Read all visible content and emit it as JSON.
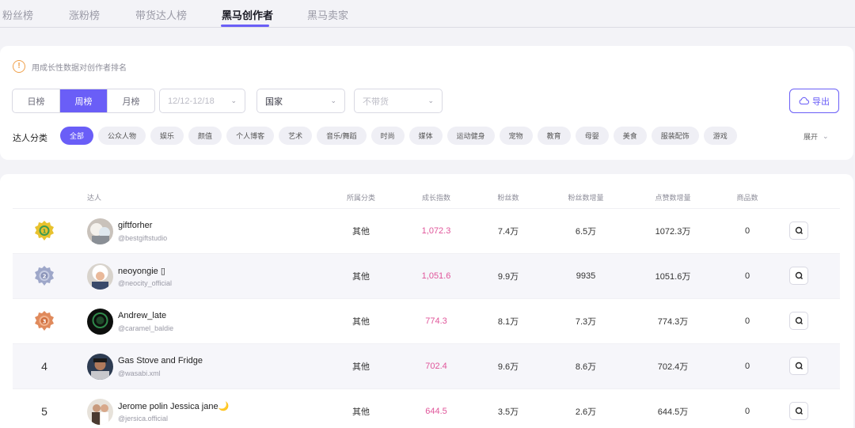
{
  "tabs": [
    {
      "label": "粉丝榜"
    },
    {
      "label": "涨粉榜"
    },
    {
      "label": "带货达人榜"
    },
    {
      "label": "黑马创作者"
    },
    {
      "label": "黑马卖家"
    }
  ],
  "active_tab": "黑马创作者",
  "filters": {
    "hint": "用成长性数据对创作者排名",
    "period": [
      "日榜",
      "周榜",
      "月榜"
    ],
    "period_selected": "周榜",
    "date_placeholder": "12/12-12/18",
    "country": "国家",
    "sales_placeholder": "不带货",
    "export_label": "导出",
    "category_label": "达人分类",
    "categories": [
      "全部",
      "公众人物",
      "娱乐",
      "颜值",
      "个人博客",
      "艺术",
      "音乐/舞蹈",
      "时尚",
      "媒体",
      "运动健身",
      "宠物",
      "教育",
      "母婴",
      "美食",
      "服装配饰",
      "游戏"
    ],
    "category_selected": "全部",
    "expand_label": "展开"
  },
  "table": {
    "headers": {
      "creator": "达人",
      "category": "所属分类",
      "growth": "成长指数",
      "fans": "粉丝数",
      "fans_growth": "粉丝数增量",
      "likes_growth": "点赞数增量",
      "products": "商品数"
    },
    "rows": [
      {
        "rank": "1",
        "medal": "gold",
        "name": "giftforher",
        "handle": "@bestgiftstudio",
        "category": "其他",
        "growth": "1,072.3",
        "fans": "7.4万",
        "fans_growth": "6.5万",
        "likes_growth": "1072.3万",
        "products": "0"
      },
      {
        "rank": "2",
        "medal": "silver",
        "name": "neoyongie ▯",
        "handle": "@neocity_official",
        "category": "其他",
        "growth": "1,051.6",
        "fans": "9.9万",
        "fans_growth": "9935",
        "likes_growth": "1051.6万",
        "products": "0"
      },
      {
        "rank": "3",
        "medal": "bronze",
        "name": "Andrew_late",
        "handle": "@caramel_baldie",
        "category": "其他",
        "growth": "774.3",
        "fans": "8.1万",
        "fans_growth": "7.3万",
        "likes_growth": "774.3万",
        "products": "0"
      },
      {
        "rank": "4",
        "medal": "",
        "name": "Gas Stove and Fridge",
        "handle": "@wasabi.xml",
        "category": "其他",
        "growth": "702.4",
        "fans": "9.6万",
        "fans_growth": "8.6万",
        "likes_growth": "702.4万",
        "products": "0"
      },
      {
        "rank": "5",
        "medal": "",
        "name": "Jerome polin Jessica jane🌙",
        "handle": "@jersica.official",
        "category": "其他",
        "growth": "644.5",
        "fans": "3.5万",
        "fans_growth": "2.6万",
        "likes_growth": "644.5万",
        "products": "0"
      }
    ]
  },
  "colors": {
    "accent": "#6a5ef7",
    "growth": "#e0559a",
    "warning": "#f0a04b",
    "gold": "#e8c22e",
    "silver": "#9ea7c9",
    "bronze": "#e08a5c"
  }
}
